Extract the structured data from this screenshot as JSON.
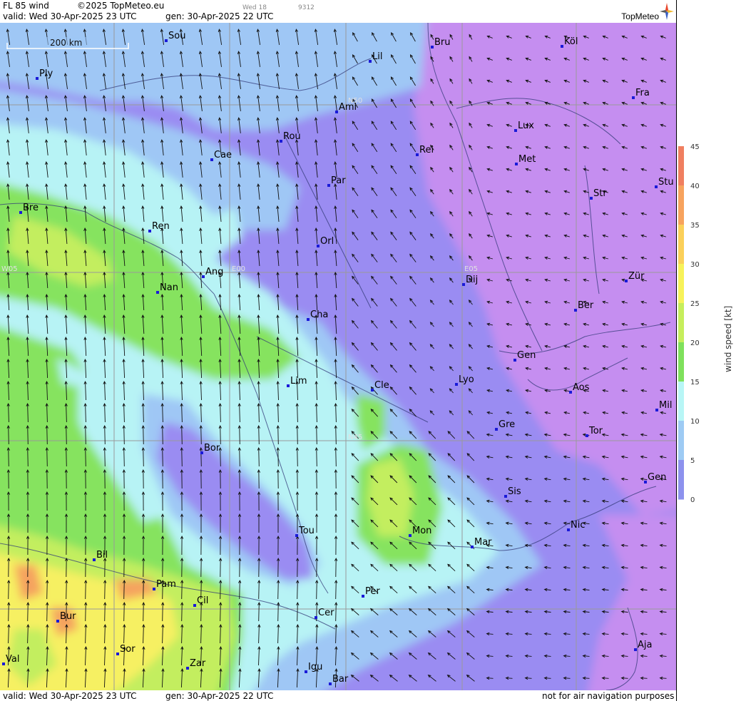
{
  "header": {
    "product": "FL 85 wind",
    "copyright": "©2025 TopMeteo.eu",
    "run_label": "Wed 18",
    "run_code": "9312",
    "valid": "valid:  Wed   30-Apr-2025  23 UTC",
    "gen": "gen:  30-Apr-2025  22 UTC",
    "logo": "TopMeteo"
  },
  "footer": {
    "valid": "valid:  Wed   30-Apr-2025  23 UTC",
    "gen": "gen:  30-Apr-2025  22 UTC",
    "disclaimer": "not for air navigation purposes"
  },
  "scale_bar": "200 km",
  "grid_labels": [
    {
      "text": "N50"
    },
    {
      "text": "N45"
    },
    {
      "text": "W05"
    },
    {
      "text": "E00"
    },
    {
      "text": "E05"
    }
  ],
  "cities": [
    "Sou",
    "Ply",
    "Bru",
    "Köl",
    "Lil",
    "Ami",
    "Fra",
    "Lux",
    "Rou",
    "Cae",
    "Rei",
    "Met",
    "Par",
    "Stu",
    "Str",
    "Bre",
    "Ren",
    "Orl",
    "Zür",
    "Ang",
    "Dij",
    "Nan",
    "Ber",
    "Cha",
    "Gen",
    "Lim",
    "Cle",
    "Lyo",
    "Aos",
    "Mil",
    "Tor",
    "Gre",
    "Bor",
    "Sis",
    "Gen",
    "Nic",
    "Tou",
    "Mon",
    "Mar",
    "Bil",
    "Pam",
    "Cil",
    "Per",
    "Cer",
    "Bur",
    "Sor",
    "Aja",
    "Zar",
    "Val",
    "Igu",
    "Bar"
  ],
  "legend": {
    "title": "wind speed [kt]",
    "ticks": [
      "45",
      "40",
      "35",
      "30",
      "25",
      "20",
      "15",
      "10",
      "5",
      "0"
    ],
    "colors": [
      "#f07f60",
      "#f7a35e",
      "#fbd05a",
      "#f7f25a",
      "#c6ee5c",
      "#7fe15d",
      "#b8f6f6",
      "#9ecbf4",
      "#8d92ee",
      "#d28ef3"
    ]
  },
  "colors": {
    "purple_light": "#c58ef0",
    "violet": "#9a8cf2",
    "blue_light": "#9fc7f5",
    "cyan": "#b7f3f5",
    "green": "#86e35f",
    "lime": "#c3ee5f",
    "yellow": "#f6f062",
    "orange": "#f5a35e"
  }
}
